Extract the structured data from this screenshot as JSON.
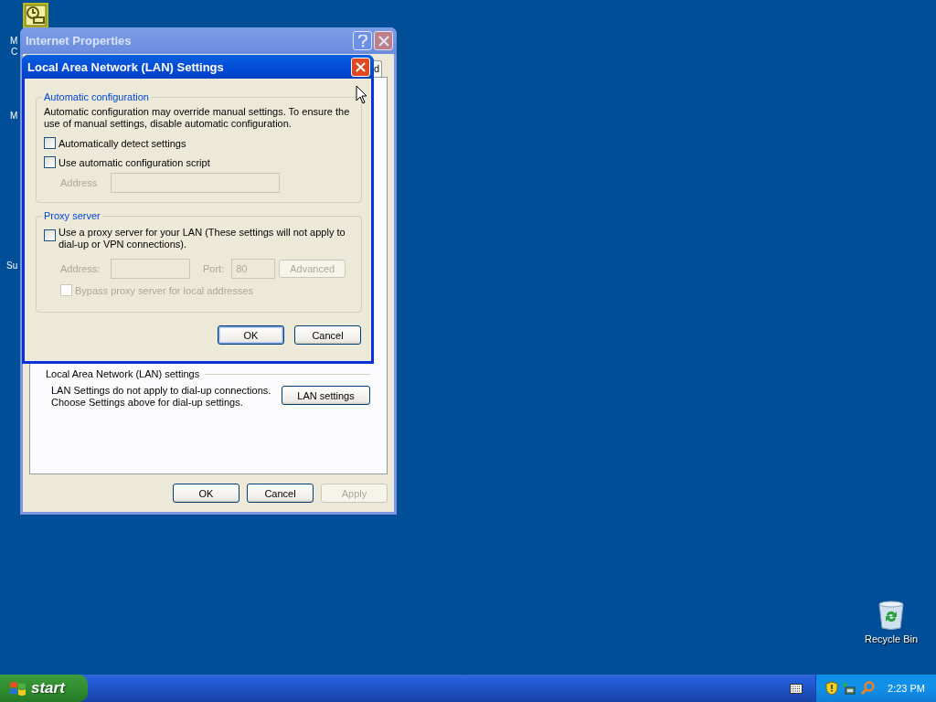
{
  "desktop": {
    "icon_fragments": [
      {
        "label": "M"
      },
      {
        "label": "C"
      },
      {
        "label": "M"
      },
      {
        "label": "Su"
      }
    ],
    "recycle_bin": {
      "label": "Recycle Bin"
    }
  },
  "internet_properties": {
    "title": "Internet Properties",
    "active": false,
    "tabs": [
      {
        "label": "d",
        "selected": false
      }
    ],
    "lan_section": {
      "title": "Local Area Network (LAN) settings",
      "description": "LAN Settings do not apply to dial-up connections.\nChoose Settings above for dial-up settings.",
      "button": "LAN settings"
    },
    "buttons": [
      {
        "label": "OK",
        "disabled": false,
        "default": false
      },
      {
        "label": "Cancel",
        "disabled": false,
        "default": false
      },
      {
        "label": "Apply",
        "disabled": true,
        "default": false
      }
    ]
  },
  "lan_dialog": {
    "title": "Local Area Network (LAN) Settings",
    "active": true,
    "automatic": {
      "title": "Automatic configuration",
      "description": "Automatic configuration may override manual settings.  To ensure the use of manual settings, disable automatic configuration.",
      "options": [
        {
          "label": "Automatically detect settings",
          "checked": false
        },
        {
          "label": "Use automatic configuration script",
          "checked": false
        }
      ],
      "address": {
        "label": "Address",
        "disabled": true
      }
    },
    "proxy": {
      "title": "Proxy server",
      "use_proxy": {
        "label": "Use a proxy server for your LAN (These settings will not apply to dial-up or VPN connections).",
        "checked": false
      },
      "address": {
        "label": "Address:",
        "disabled": true
      },
      "port": {
        "label": "Port:",
        "value": "80",
        "disabled": true
      },
      "advanced": {
        "label": "Advanced",
        "disabled": true
      },
      "bypass": {
        "label": "Bypass proxy server for local addresses",
        "checked": false,
        "disabled": true
      }
    },
    "buttons": [
      {
        "label": "OK",
        "disabled": false,
        "default": true
      },
      {
        "label": "Cancel",
        "disabled": false,
        "default": false
      }
    ]
  },
  "taskbar": {
    "start": "start",
    "clock": "2:23 PM"
  }
}
